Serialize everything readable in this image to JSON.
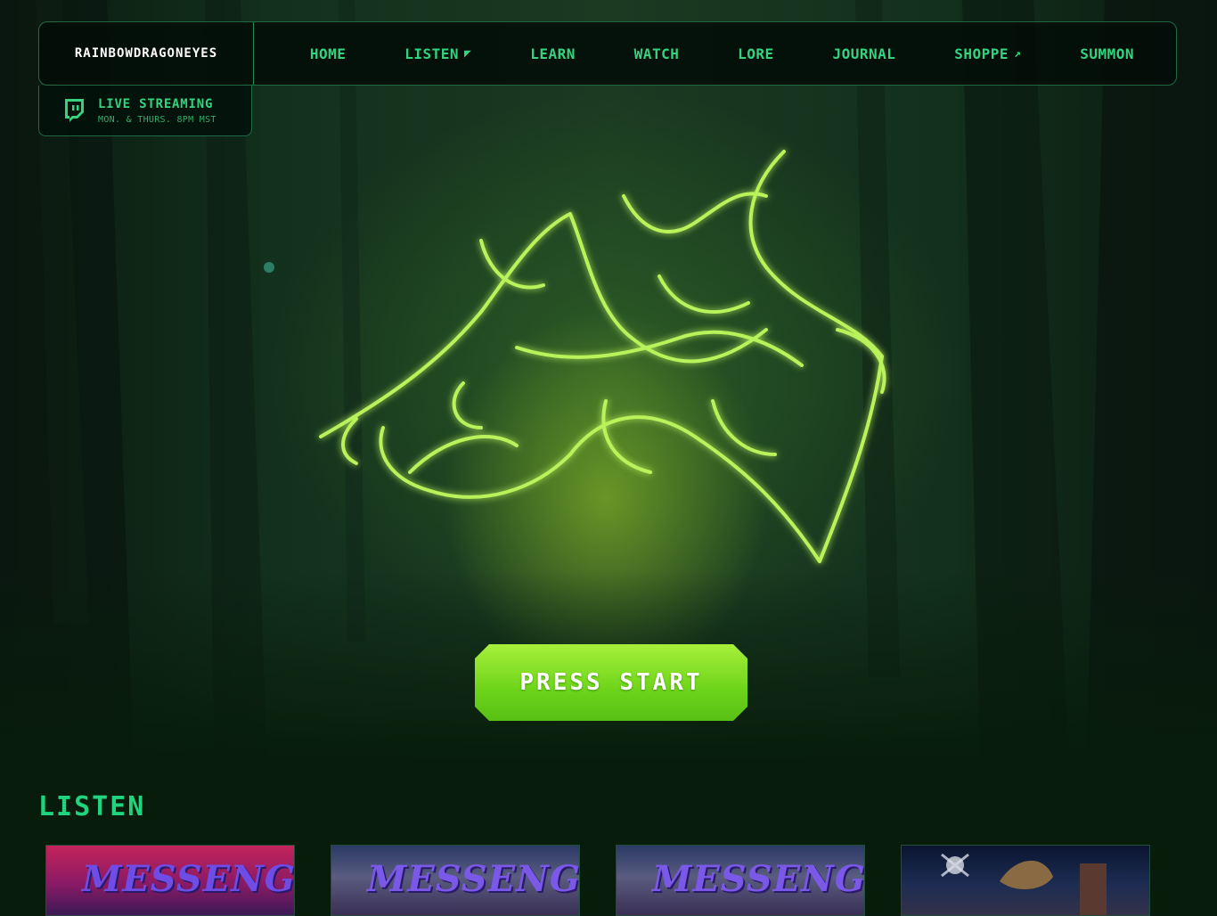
{
  "nav": {
    "brand": "RAINBOWDRAGONEYES",
    "items": [
      {
        "label": "HOME",
        "icon": null
      },
      {
        "label": "LISTEN",
        "icon": "dropdown-corner-arrow"
      },
      {
        "label": "LEARN",
        "icon": null
      },
      {
        "label": "WATCH",
        "icon": null
      },
      {
        "label": "LORE",
        "icon": null
      },
      {
        "label": "JOURNAL",
        "icon": null
      },
      {
        "label": "SHOPPE",
        "icon": "external-arrow"
      },
      {
        "label": "SUMMON",
        "icon": null
      }
    ]
  },
  "live": {
    "icon": "twitch-icon",
    "title": "LIVE STREAMING",
    "schedule": "MON. & THURS. 8PM MST"
  },
  "hero": {
    "logo": "stylized calligraphic band logo (glowing green)",
    "cta": "PRESS START"
  },
  "listen": {
    "title": "LISTEN",
    "cards": [
      {
        "title": "MESSENGER"
      },
      {
        "title": "MESSENGER"
      },
      {
        "title": "MESSENGER"
      },
      {
        "title": ""
      }
    ]
  },
  "colors": {
    "accent": "#35d37f",
    "button": "#7ed622",
    "background": "#071c0a"
  }
}
